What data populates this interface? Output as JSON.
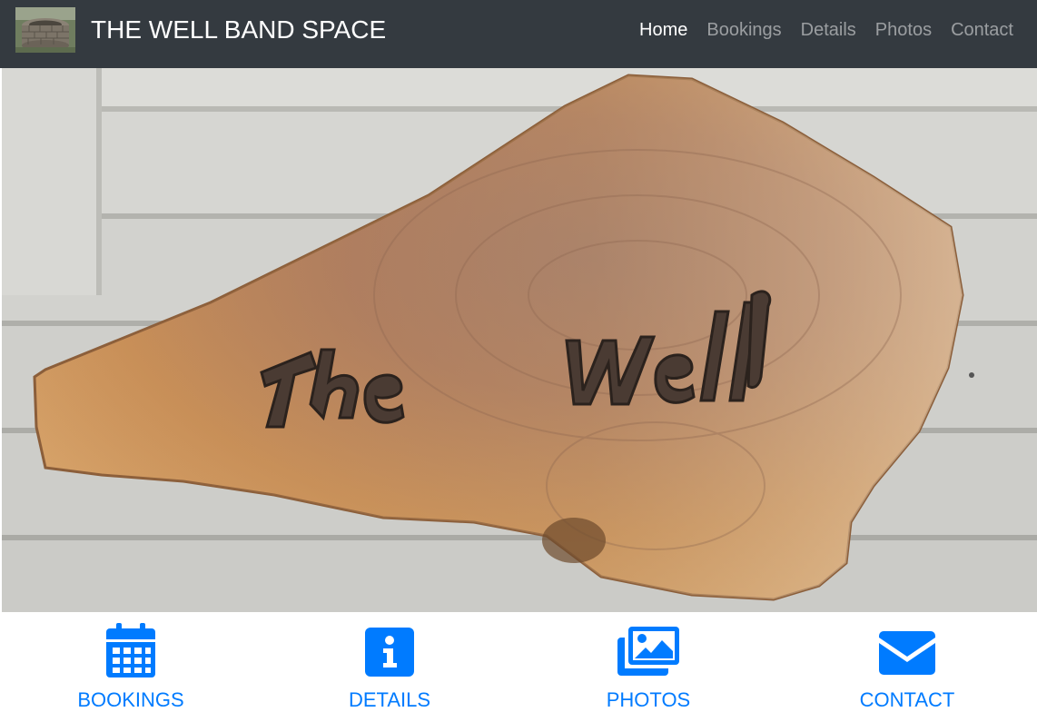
{
  "brand": {
    "title": "THE WELL BAND SPACE",
    "logo_icon": "stone-well-photo"
  },
  "nav": {
    "items": [
      {
        "label": "Home",
        "active": true
      },
      {
        "label": "Bookings",
        "active": false
      },
      {
        "label": "Details",
        "active": false
      },
      {
        "label": "Photos",
        "active": false
      },
      {
        "label": "Contact",
        "active": false
      }
    ]
  },
  "hero": {
    "subject": "wooden slab sign on siding",
    "sign_text": "The Well"
  },
  "features": [
    {
      "label": "BOOKINGS",
      "icon": "calendar-icon"
    },
    {
      "label": "DETAILS",
      "icon": "info-icon"
    },
    {
      "label": "PHOTOS",
      "icon": "images-icon"
    },
    {
      "label": "CONTACT",
      "icon": "envelope-icon"
    }
  ],
  "colors": {
    "navbar": "#343a40",
    "accent": "#007bff",
    "nav_active": "#ffffff",
    "nav_inactive": "rgba(255,255,255,0.5)"
  }
}
